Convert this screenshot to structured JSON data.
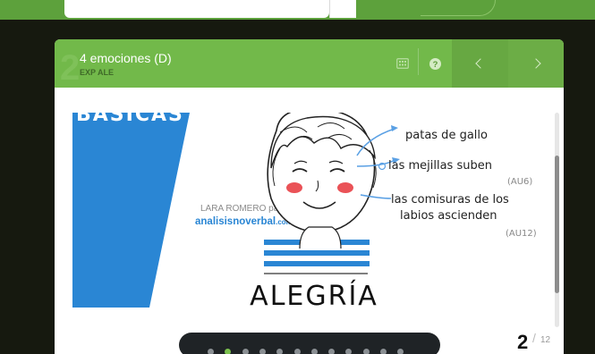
{
  "deck": {
    "title": "4 emociones (D)",
    "subtitle": "EXP ALE"
  },
  "slide": {
    "heading_fragment": "BÁSICAS",
    "credit_author": "LARA ROMERO para",
    "credit_site": "analisisnoverbal",
    "credit_domain": ".com",
    "emotion": "ALEGRÍA",
    "annotations": {
      "a1": "patas de gallo",
      "a2": "las mejillas suben",
      "a2_code": "(AU6)",
      "a3_line1": "las comisuras de los",
      "a3_line2": "labios ascienden",
      "a3_code": "(AU12)"
    }
  },
  "pager": {
    "current": "2",
    "separator": "/",
    "total": "12"
  },
  "dots": {
    "count": 12,
    "active_index": 1
  },
  "icons": {
    "grid": "grid-icon",
    "help": "question-mark-icon",
    "prev": "chevron-left-icon",
    "next": "chevron-right-icon"
  },
  "colors": {
    "header_green": "#72b94a",
    "accent_blue": "#2a86d4",
    "cheek_red": "#e6343a",
    "arrow_blue": "#5aa0e4"
  }
}
